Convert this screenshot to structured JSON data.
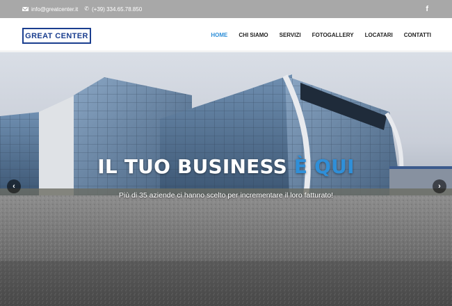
{
  "topbar": {
    "email": "info@greatcenter.it",
    "phone": "(+39) 334.65.78.850",
    "social_icon": "f"
  },
  "header": {
    "logo_text": "GREAT CENTER",
    "nav": [
      {
        "label": "HOME",
        "active": true
      },
      {
        "label": "CHI SIAMO",
        "active": false
      },
      {
        "label": "SERVIZI",
        "active": false
      },
      {
        "label": "FOTOGALLERY",
        "active": false
      },
      {
        "label": "LOCATARI",
        "active": false
      },
      {
        "label": "CONTATTI",
        "active": false
      }
    ]
  },
  "hero": {
    "title_main": "IL TUO BUSINESS ",
    "title_accent": "È QUI",
    "subtitle": "Più di 35 aziende ci hanno scelto per incrementare il loro fatturato!",
    "prev_glyph": "‹",
    "next_glyph": "›"
  },
  "colors": {
    "accent": "#2f8fd8",
    "logo": "#1a3e8f",
    "topbar": "#a8a8a8"
  }
}
